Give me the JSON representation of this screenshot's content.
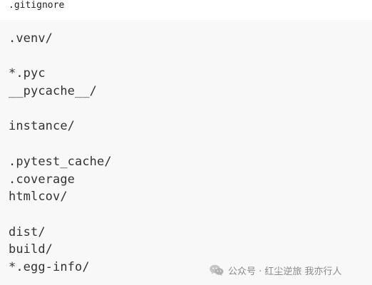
{
  "file": {
    "name": ".gitignore"
  },
  "code": {
    "lines": [
      ".venv/",
      "",
      "*.pyc",
      "__pycache__/",
      "",
      "instance/",
      "",
      ".pytest_cache/",
      ".coverage",
      "htmlcov/",
      "",
      "dist/",
      "build/",
      "*.egg-info/"
    ]
  },
  "watermark": {
    "icon": "wechat-icon",
    "text": "公众号 · 红尘逆旅 我亦行人"
  }
}
